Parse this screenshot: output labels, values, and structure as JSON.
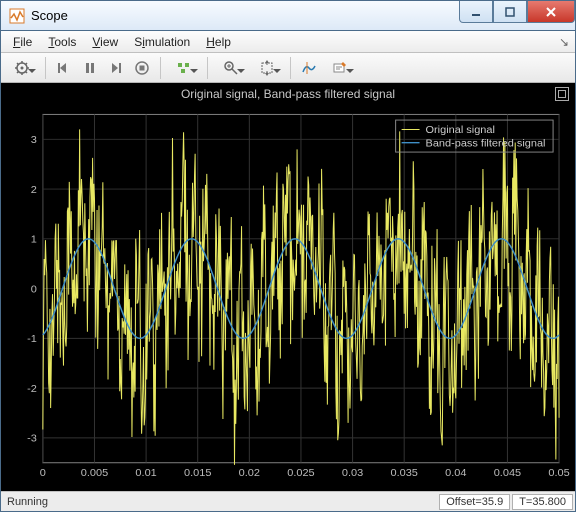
{
  "window": {
    "title": "Scope"
  },
  "menubar": {
    "file": "File",
    "tools": "Tools",
    "view": "View",
    "simulation": "Simulation",
    "help": "Help"
  },
  "toolbar": {
    "settings": "Settings",
    "step_back": "Step Back",
    "pause": "Pause",
    "step_fwd": "Step Forward",
    "stop": "Stop",
    "triggers": "Triggers",
    "zoom": "Zoom",
    "autoscale": "Autoscale",
    "cursor": "Cursor Measurements",
    "annotate": "Annotate"
  },
  "plot": {
    "title": "Original signal, Band-pass filtered signal",
    "legend": {
      "s1": "Original signal",
      "s2": "Band-pass filtered signal"
    },
    "y_ticks": [
      "-3",
      "-2",
      "-1",
      "0",
      "1",
      "2",
      "3"
    ],
    "x_ticks": [
      "0",
      "0.005",
      "0.01",
      "0.015",
      "0.02",
      "0.025",
      "0.03",
      "0.035",
      "0.04",
      "0.045",
      "0.05"
    ]
  },
  "chart_data": {
    "type": "line",
    "title": "Original signal, Band-pass filtered signal",
    "xlabel": "",
    "ylabel": "",
    "xlim": [
      0,
      0.05
    ],
    "ylim": [
      -3.5,
      3.5
    ],
    "series": [
      {
        "name": "Original signal",
        "color": "#e8e862",
        "description": "Noisy composite signal with dominant 100 Hz component plus higher-frequency noise, amplitude roughly ±3"
      },
      {
        "name": "Band-pass filtered signal",
        "color": "#3f8fc7",
        "description": "Smooth 100 Hz sinusoid, amplitude ~1, recovered by band-pass filter"
      }
    ],
    "x_tick_values": [
      0,
      0.005,
      0.01,
      0.015,
      0.02,
      0.025,
      0.03,
      0.035,
      0.04,
      0.045,
      0.05
    ],
    "y_tick_values": [
      -3,
      -2,
      -1,
      0,
      1,
      2,
      3
    ]
  },
  "status": {
    "state": "Running",
    "offset": "Offset=35.9",
    "time": "T=35.800"
  }
}
